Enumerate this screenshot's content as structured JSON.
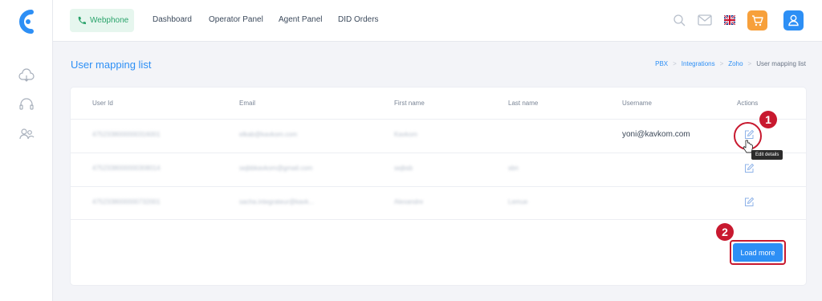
{
  "sidebar": {
    "logo": "brand-logo",
    "items": [
      {
        "icon": "cloud-icon"
      },
      {
        "icon": "headset-icon"
      },
      {
        "icon": "users-icon"
      }
    ]
  },
  "topbar": {
    "webphone_label": "Webphone",
    "nav": [
      "Dashboard",
      "Operator Panel",
      "Agent Panel",
      "DID Orders"
    ],
    "icons": [
      "search-icon",
      "mail-icon",
      "uk-flag-icon",
      "cart-icon",
      "user-icon"
    ]
  },
  "page": {
    "title": "User mapping list",
    "breadcrumb": [
      "PBX",
      "Integrations",
      "Zoho",
      "User mapping list"
    ]
  },
  "table": {
    "columns": [
      "User Id",
      "Email",
      "First name",
      "Last name",
      "Username",
      "Actions"
    ],
    "rows": [
      {
        "user_id": "4752338000000316001",
        "email": "elkab@kavkom.com",
        "first_name": "Kavkom",
        "last_name": "",
        "username": "yoni@kavkom.com"
      },
      {
        "user_id": "4752338000000308014",
        "email": "sejbbkavkom@gmail.com",
        "first_name": "sejbsb",
        "last_name": "sbn",
        "username": ""
      },
      {
        "user_id": "4752338000000732001",
        "email": "sacha.integrateur@kavk...",
        "first_name": "Alexandre",
        "last_name": "Lemue",
        "username": ""
      }
    ],
    "tooltip": "Edit details",
    "load_more": "Load more"
  },
  "annotations": {
    "step1": "1",
    "step2": "2"
  },
  "colors": {
    "accent": "#2d8ff5",
    "annotation": "#c8192f",
    "success": "#2aa36b",
    "cart": "#f7a03b"
  }
}
